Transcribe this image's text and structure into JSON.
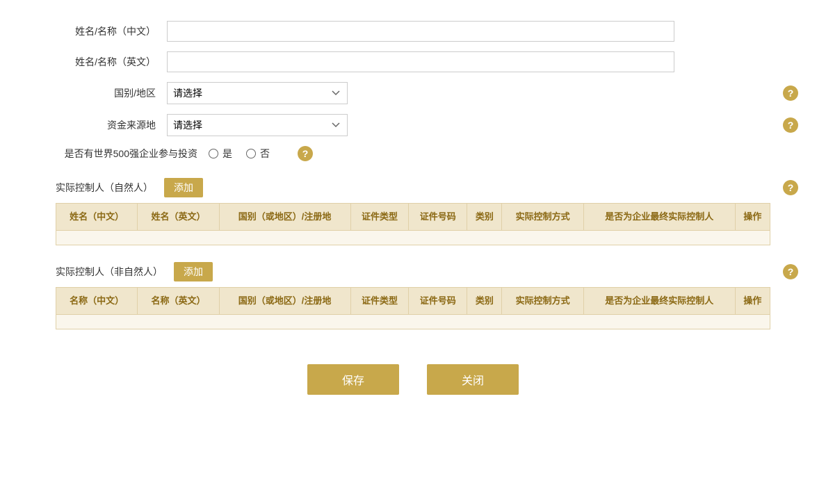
{
  "form": {
    "name_cn_label": "姓名/名称（中文）",
    "name_en_label": "姓名/名称（英文）",
    "country_label": "国别/地区",
    "country_placeholder": "请选择",
    "fund_source_label": "资金来源地",
    "fund_source_placeholder": "请选择",
    "fortune500_label": "是否有世界500强企业参与投资",
    "radio_yes": "是",
    "radio_no": "否"
  },
  "controller_natural": {
    "title": "实际控制人（自然人）",
    "add_label": "添加",
    "columns": [
      "姓名（中文）",
      "姓名（英文）",
      "国别（或地区）/注册地",
      "证件类型",
      "证件号码",
      "类别",
      "实际控制方式",
      "是否为企业最终实际控制人",
      "操作"
    ]
  },
  "controller_non_natural": {
    "title": "实际控制人（非自然人）",
    "add_label": "添加",
    "columns": [
      "名称（中文）",
      "名称（英文）",
      "国别（或地区）/注册地",
      "证件类型",
      "证件号码",
      "类别",
      "实际控制方式",
      "是否为企业最终实际控制人",
      "操作"
    ]
  },
  "buttons": {
    "save": "保存",
    "close": "关闭"
  },
  "help_icon": "?"
}
